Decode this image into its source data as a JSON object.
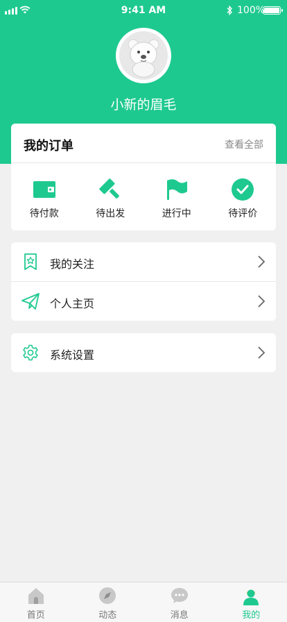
{
  "status_bar": {
    "time": "9:41 AM",
    "battery": "100%"
  },
  "profile": {
    "username": "小新的眉毛"
  },
  "orders": {
    "title": "我的订单",
    "view_all": "查看全部",
    "items": [
      {
        "label": "待付款",
        "icon": "wallet-icon"
      },
      {
        "label": "待出发",
        "icon": "hammer-icon"
      },
      {
        "label": "进行中",
        "icon": "flag-icon"
      },
      {
        "label": "待评价",
        "icon": "check-circle-icon"
      }
    ]
  },
  "menu": [
    {
      "label": "我的关注",
      "icon": "star-bookmark-icon"
    },
    {
      "label": "个人主页",
      "icon": "paper-plane-icon"
    },
    {
      "label": "系统设置",
      "icon": "gear-icon"
    }
  ],
  "tabs": [
    {
      "label": "首页",
      "icon": "home-icon"
    },
    {
      "label": "动态",
      "icon": "compass-icon"
    },
    {
      "label": "消息",
      "icon": "chat-icon"
    },
    {
      "label": "我的",
      "icon": "user-icon",
      "active": true
    }
  ],
  "colors": {
    "accent": "#1ec990",
    "background": "#f0f0f0"
  }
}
